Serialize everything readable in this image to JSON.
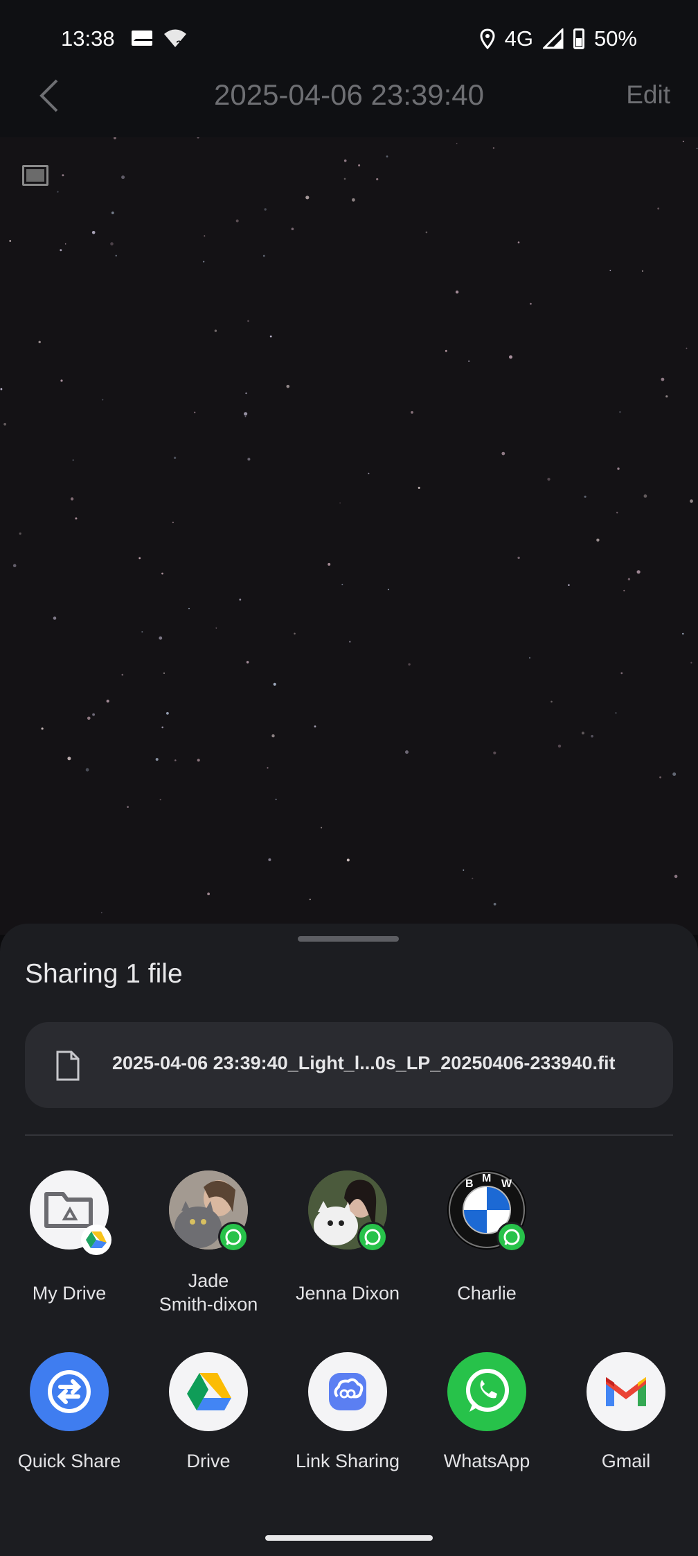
{
  "status_bar": {
    "time": "13:38",
    "network": "4G",
    "battery": "50%"
  },
  "header": {
    "title": "2025-04-06  23:39:40",
    "edit_label": "Edit"
  },
  "share_sheet": {
    "title": "Sharing 1 file",
    "file_name": "2025-04-06 23:39:40_Light_l...0s_LP_20250406-233940.fit",
    "direct_share": [
      {
        "label": "My Drive",
        "icon": "drive-folder-icon"
      },
      {
        "label": "Jade\nSmith-dixon",
        "icon": "avatar"
      },
      {
        "label": "Jenna Dixon",
        "icon": "avatar"
      },
      {
        "label": "Charlie",
        "icon": "bmw-logo"
      }
    ],
    "apps": [
      {
        "label": "Quick Share",
        "icon": "quick-share-icon"
      },
      {
        "label": "Drive",
        "icon": "drive-icon"
      },
      {
        "label": "Link Sharing",
        "icon": "link-sharing-icon"
      },
      {
        "label": "WhatsApp",
        "icon": "whatsapp-icon"
      },
      {
        "label": "Gmail",
        "icon": "gmail-icon"
      }
    ]
  },
  "colors": {
    "sheet_bg": "#1c1d21",
    "whatsapp": "#27c24a",
    "quick_share": "#3f7df0"
  }
}
